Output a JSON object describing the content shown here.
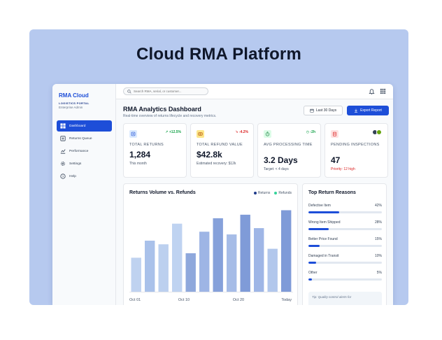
{
  "hero": {
    "title": "Cloud RMA Platform"
  },
  "sidebar": {
    "brand": "RMA Cloud",
    "subtitle": "LOGISTICS PORTAL",
    "role": "Enterprise Admin",
    "items": [
      {
        "label": "Dashboard",
        "icon": "dashboard-icon",
        "active": true
      },
      {
        "label": "Returns Queue",
        "icon": "returns-queue-icon",
        "active": false
      },
      {
        "label": "Performance",
        "icon": "performance-icon",
        "active": false
      },
      {
        "label": "Settings",
        "icon": "gear-icon",
        "active": false
      },
      {
        "label": "Help",
        "icon": "help-icon",
        "active": false
      }
    ]
  },
  "topbar": {
    "search_placeholder": "Search RMA, serial, or customer..."
  },
  "header": {
    "title": "RMA Analytics Dashboard",
    "subtitle": "Real-time overview of returns lifecycle and recovery metrics.",
    "range_label": "Last 30 Days",
    "export_label": "Export Report"
  },
  "cards": [
    {
      "label": "TOTAL RETURNS",
      "value": "1,284",
      "note": "This month",
      "delta": "+12.5%",
      "delta_color": "#16a34a",
      "icon": "box-icon",
      "icon_bg": "#dbeafe",
      "icon_color": "#1d4ed8"
    },
    {
      "label": "TOTAL REFUND VALUE",
      "value": "$42.8k",
      "note": "Estimated recovery: $12k",
      "delta": "-4.2%",
      "delta_color": "#dc2626",
      "icon": "money-icon",
      "icon_bg": "#fde68a",
      "icon_color": "#b45309"
    },
    {
      "label": "AVG PROCESSING TIME",
      "value": "3.2 Days",
      "note": "Target: < 4 days",
      "delta": "-2h",
      "delta_color": "#16a34a",
      "icon": "stopwatch-icon",
      "icon_bg": "#dcfce7",
      "icon_color": "#15803d"
    },
    {
      "label": "PENDING INSPECTIONS",
      "value": "47",
      "note": "Priority: 12 high",
      "delta": "",
      "delta_color": "#dc2626",
      "icon": "clipboard-icon",
      "icon_bg": "#fee2e2",
      "icon_color": "#dc2626"
    }
  ],
  "chart_data": {
    "type": "bar",
    "title": "Returns Volume vs. Refunds",
    "legend": [
      "Returns",
      "Refunds"
    ],
    "legend_colors": [
      "#1e3a8a",
      "#34d399"
    ],
    "x_tick_labels": [
      "Oct 01",
      "Oct 10",
      "Oct 20",
      "Today"
    ],
    "values": [
      38,
      57,
      53,
      76,
      43,
      67,
      82,
      64,
      86,
      71,
      48,
      91
    ],
    "ylim": [
      0,
      100
    ],
    "grid": false
  },
  "reasons": {
    "title": "Top Return Reasons",
    "items": [
      {
        "label": "Defective Item",
        "pct_label": "42%",
        "value": 42
      },
      {
        "label": "Wrong Item Shipped",
        "pct_label": "28%",
        "value": 28
      },
      {
        "label": "Better Price Found",
        "pct_label": "15%",
        "value": 15
      },
      {
        "label": "Damaged in Transit",
        "pct_label": "10%",
        "value": 10
      },
      {
        "label": "Other",
        "pct_label": "5%",
        "value": 5
      }
    ],
    "tip": "Tip: Quality control alerts for"
  }
}
